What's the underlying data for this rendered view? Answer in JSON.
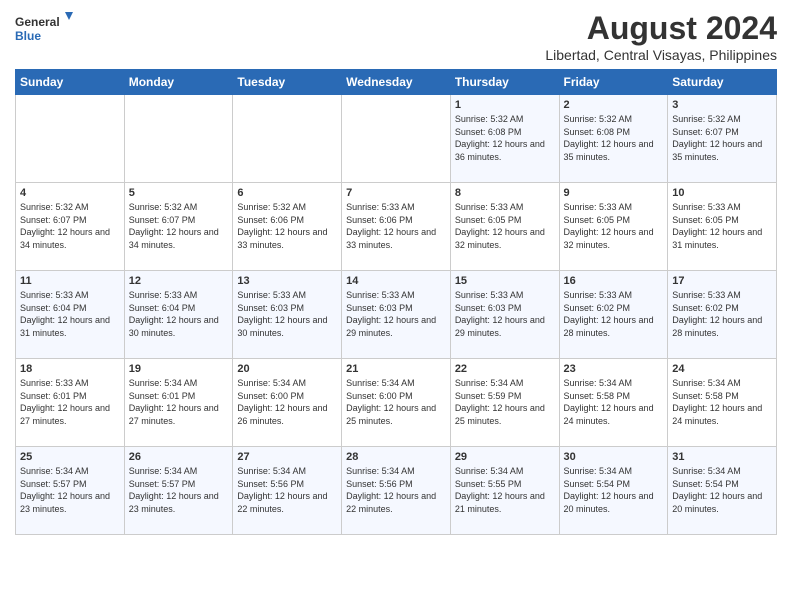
{
  "logo": {
    "general": "General",
    "blue": "Blue"
  },
  "title": "August 2024",
  "subtitle": "Libertad, Central Visayas, Philippines",
  "days_of_week": [
    "Sunday",
    "Monday",
    "Tuesday",
    "Wednesday",
    "Thursday",
    "Friday",
    "Saturday"
  ],
  "weeks": [
    [
      {
        "day": "",
        "info": ""
      },
      {
        "day": "",
        "info": ""
      },
      {
        "day": "",
        "info": ""
      },
      {
        "day": "",
        "info": ""
      },
      {
        "day": "1",
        "info": "Sunrise: 5:32 AM\nSunset: 6:08 PM\nDaylight: 12 hours and 36 minutes."
      },
      {
        "day": "2",
        "info": "Sunrise: 5:32 AM\nSunset: 6:08 PM\nDaylight: 12 hours and 35 minutes."
      },
      {
        "day": "3",
        "info": "Sunrise: 5:32 AM\nSunset: 6:07 PM\nDaylight: 12 hours and 35 minutes."
      }
    ],
    [
      {
        "day": "4",
        "info": "Sunrise: 5:32 AM\nSunset: 6:07 PM\nDaylight: 12 hours and 34 minutes."
      },
      {
        "day": "5",
        "info": "Sunrise: 5:32 AM\nSunset: 6:07 PM\nDaylight: 12 hours and 34 minutes."
      },
      {
        "day": "6",
        "info": "Sunrise: 5:32 AM\nSunset: 6:06 PM\nDaylight: 12 hours and 33 minutes."
      },
      {
        "day": "7",
        "info": "Sunrise: 5:33 AM\nSunset: 6:06 PM\nDaylight: 12 hours and 33 minutes."
      },
      {
        "day": "8",
        "info": "Sunrise: 5:33 AM\nSunset: 6:05 PM\nDaylight: 12 hours and 32 minutes."
      },
      {
        "day": "9",
        "info": "Sunrise: 5:33 AM\nSunset: 6:05 PM\nDaylight: 12 hours and 32 minutes."
      },
      {
        "day": "10",
        "info": "Sunrise: 5:33 AM\nSunset: 6:05 PM\nDaylight: 12 hours and 31 minutes."
      }
    ],
    [
      {
        "day": "11",
        "info": "Sunrise: 5:33 AM\nSunset: 6:04 PM\nDaylight: 12 hours and 31 minutes."
      },
      {
        "day": "12",
        "info": "Sunrise: 5:33 AM\nSunset: 6:04 PM\nDaylight: 12 hours and 30 minutes."
      },
      {
        "day": "13",
        "info": "Sunrise: 5:33 AM\nSunset: 6:03 PM\nDaylight: 12 hours and 30 minutes."
      },
      {
        "day": "14",
        "info": "Sunrise: 5:33 AM\nSunset: 6:03 PM\nDaylight: 12 hours and 29 minutes."
      },
      {
        "day": "15",
        "info": "Sunrise: 5:33 AM\nSunset: 6:03 PM\nDaylight: 12 hours and 29 minutes."
      },
      {
        "day": "16",
        "info": "Sunrise: 5:33 AM\nSunset: 6:02 PM\nDaylight: 12 hours and 28 minutes."
      },
      {
        "day": "17",
        "info": "Sunrise: 5:33 AM\nSunset: 6:02 PM\nDaylight: 12 hours and 28 minutes."
      }
    ],
    [
      {
        "day": "18",
        "info": "Sunrise: 5:33 AM\nSunset: 6:01 PM\nDaylight: 12 hours and 27 minutes."
      },
      {
        "day": "19",
        "info": "Sunrise: 5:34 AM\nSunset: 6:01 PM\nDaylight: 12 hours and 27 minutes."
      },
      {
        "day": "20",
        "info": "Sunrise: 5:34 AM\nSunset: 6:00 PM\nDaylight: 12 hours and 26 minutes."
      },
      {
        "day": "21",
        "info": "Sunrise: 5:34 AM\nSunset: 6:00 PM\nDaylight: 12 hours and 25 minutes."
      },
      {
        "day": "22",
        "info": "Sunrise: 5:34 AM\nSunset: 5:59 PM\nDaylight: 12 hours and 25 minutes."
      },
      {
        "day": "23",
        "info": "Sunrise: 5:34 AM\nSunset: 5:58 PM\nDaylight: 12 hours and 24 minutes."
      },
      {
        "day": "24",
        "info": "Sunrise: 5:34 AM\nSunset: 5:58 PM\nDaylight: 12 hours and 24 minutes."
      }
    ],
    [
      {
        "day": "25",
        "info": "Sunrise: 5:34 AM\nSunset: 5:57 PM\nDaylight: 12 hours and 23 minutes."
      },
      {
        "day": "26",
        "info": "Sunrise: 5:34 AM\nSunset: 5:57 PM\nDaylight: 12 hours and 23 minutes."
      },
      {
        "day": "27",
        "info": "Sunrise: 5:34 AM\nSunset: 5:56 PM\nDaylight: 12 hours and 22 minutes."
      },
      {
        "day": "28",
        "info": "Sunrise: 5:34 AM\nSunset: 5:56 PM\nDaylight: 12 hours and 22 minutes."
      },
      {
        "day": "29",
        "info": "Sunrise: 5:34 AM\nSunset: 5:55 PM\nDaylight: 12 hours and 21 minutes."
      },
      {
        "day": "30",
        "info": "Sunrise: 5:34 AM\nSunset: 5:54 PM\nDaylight: 12 hours and 20 minutes."
      },
      {
        "day": "31",
        "info": "Sunrise: 5:34 AM\nSunset: 5:54 PM\nDaylight: 12 hours and 20 minutes."
      }
    ]
  ]
}
